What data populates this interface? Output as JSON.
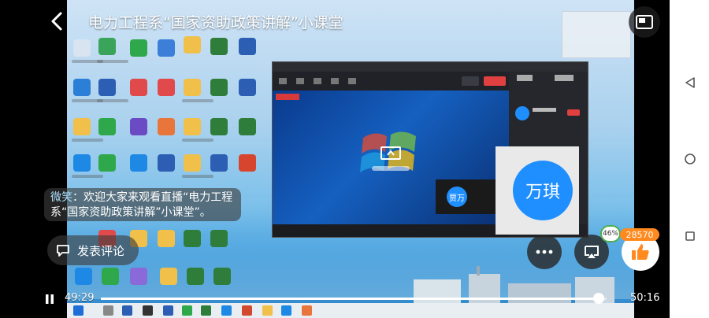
{
  "header": {
    "title": "电力工程系“国家资助政策讲解”小课堂"
  },
  "chat": {
    "user": "微笑",
    "message": "：欢迎大家来观看直播“电力工程系“国家资助政策讲解”小课堂”。"
  },
  "comment": {
    "label": "发表评论"
  },
  "participants": {
    "mini_name": "贾万",
    "big_name": "万琪"
  },
  "like": {
    "count": "28570"
  },
  "badge": {
    "percent": "46%"
  },
  "player": {
    "current_time": "49:29",
    "total_time": "50:16",
    "progress": 0.984
  },
  "colors": {
    "avatar_blue": "#1f8fff",
    "like_orange": "#ff8a1f"
  }
}
